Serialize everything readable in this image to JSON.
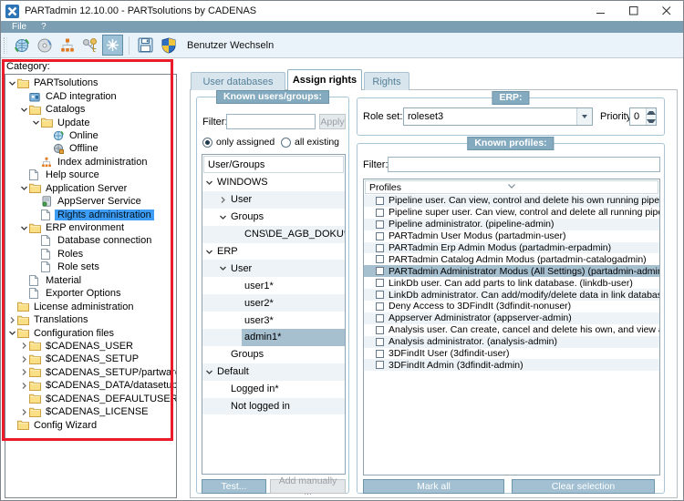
{
  "window": {
    "title": "PARTadmin 12.10.00 - PARTsolutions by CADENAS",
    "icons": [
      "app-logo-icon",
      "minimize-icon",
      "maximize-icon",
      "close-icon"
    ]
  },
  "menu": {
    "items": [
      {
        "label": "File"
      },
      {
        "label": "?"
      }
    ]
  },
  "toolbar": {
    "icons": [
      "update-online-icon",
      "update-offline-icon",
      "index-administration-icon",
      "rights-administration-icon",
      "active-category-icon",
      "save-icon",
      "switch-user-shield-icon"
    ],
    "switch_user_label": "Benutzer Wechseln"
  },
  "category_panel": {
    "label": "Category:",
    "items": [
      {
        "label": "PARTsolutions",
        "icon": "folder-icon",
        "level": 0,
        "arrow": "v"
      },
      {
        "label": "CAD integration",
        "icon": "cad-integration-icon",
        "level": 1
      },
      {
        "label": "Catalogs",
        "icon": "folder-icon",
        "level": 1,
        "arrow": "v"
      },
      {
        "label": "Update",
        "icon": "folder-icon",
        "level": 2,
        "arrow": "v"
      },
      {
        "label": "Online",
        "icon": "online-icon",
        "level": 3
      },
      {
        "label": "Offline",
        "icon": "offline-icon",
        "level": 3
      },
      {
        "label": "Index administration",
        "icon": "index-administration-icon",
        "level": 2
      },
      {
        "label": "Help source",
        "icon": "document-icon",
        "level": 1
      },
      {
        "label": "Application Server",
        "icon": "folder-icon",
        "level": 1,
        "arrow": "v"
      },
      {
        "label": "AppServer Service",
        "icon": "appserver-service-icon",
        "level": 2
      },
      {
        "label": "Rights administration",
        "icon": "document-icon",
        "level": 2,
        "selected": true
      },
      {
        "label": "ERP environment",
        "icon": "folder-icon",
        "level": 1,
        "arrow": "v"
      },
      {
        "label": "Database connection",
        "icon": "document-icon",
        "level": 2
      },
      {
        "label": "Roles",
        "icon": "document-icon",
        "level": 2
      },
      {
        "label": "Role sets",
        "icon": "document-icon",
        "level": 2
      },
      {
        "label": "Material",
        "icon": "document-icon",
        "level": 1
      },
      {
        "label": "Exporter Options",
        "icon": "document-icon",
        "level": 1
      },
      {
        "label": "License administration",
        "icon": "folder-icon",
        "level": 0
      },
      {
        "label": "Translations",
        "icon": "folder-icon",
        "level": 0,
        "arrow": ">"
      },
      {
        "label": "Configuration files",
        "icon": "folder-icon",
        "level": 0,
        "arrow": "v"
      },
      {
        "label": "$CADENAS_USER",
        "icon": "folder-icon",
        "level": 1,
        "arrow": ">"
      },
      {
        "label": "$CADENAS_SETUP",
        "icon": "folder-icon",
        "level": 1,
        "arrow": ">"
      },
      {
        "label": "$CADENAS_SETUP/partwarehouse",
        "icon": "folder-icon",
        "level": 1,
        "arrow": ">"
      },
      {
        "label": "$CADENAS_DATA/datasetup",
        "icon": "folder-icon",
        "level": 1,
        "arrow": ">"
      },
      {
        "label": "$CADENAS_DEFAULTUSER",
        "icon": "folder-icon",
        "level": 1
      },
      {
        "label": "$CADENAS_LICENSE",
        "icon": "folder-icon",
        "level": 1,
        "arrow": ">"
      },
      {
        "label": "Config Wizard",
        "icon": "folder-icon",
        "level": 0
      }
    ]
  },
  "annotation": {
    "color": "#ea1c2c"
  },
  "tabs": [
    {
      "label": "User databases",
      "active": false
    },
    {
      "label": "Assign rights",
      "active": true
    },
    {
      "label": "Rights",
      "active": false
    }
  ],
  "known_users_groups": {
    "group_label": "Known users/groups:",
    "filter_label": "Filter:",
    "filter_value": "",
    "apply_label": "Apply",
    "radio_only_assigned": "only assigned",
    "radio_all_existing": "all existing",
    "radio_selected": "only assigned",
    "list_header": "User/Groups",
    "items": [
      {
        "label": "WINDOWS",
        "level": 0,
        "arrow": "v"
      },
      {
        "label": "User",
        "level": 1,
        "arrow": ">"
      },
      {
        "label": "Groups",
        "level": 1,
        "arrow": "v"
      },
      {
        "label": "CNS\\DE_AGB_DOKU*",
        "level": 2
      },
      {
        "label": "ERP",
        "level": 0,
        "arrow": "v"
      },
      {
        "label": "User",
        "level": 1,
        "arrow": "v"
      },
      {
        "label": "user1*",
        "level": 2
      },
      {
        "label": "user2*",
        "level": 2
      },
      {
        "label": "user3*",
        "level": 2
      },
      {
        "label": "admin1*",
        "level": 2,
        "selected": true
      },
      {
        "label": "Groups",
        "level": 1
      },
      {
        "label": "Default",
        "level": 0,
        "arrow": "v"
      },
      {
        "label": "Logged in*",
        "level": 1
      },
      {
        "label": "Not logged in",
        "level": 1
      }
    ],
    "test_button": "Test...",
    "add_manually_button": "Add manually ..."
  },
  "erp": {
    "group_label": "ERP:",
    "role_set_label": "Role set:",
    "role_set_value": "roleset3",
    "priority_label": "Priority:",
    "priority_value": "0"
  },
  "known_profiles": {
    "group_label": "Known profiles:",
    "filter_label": "Filter:",
    "filter_value": "",
    "list_header": "Profiles",
    "items": [
      {
        "label": "Pipeline user. Can view, control and delete his own running pipelines. C...",
        "checked": false
      },
      {
        "label": "Pipeline super user. Can view, control and delete all running pipelines. (...",
        "checked": false
      },
      {
        "label": "Pipeline administrator. (pipeline-admin)",
        "checked": false
      },
      {
        "label": "PARTadmin User Modus (partadmin-user)",
        "checked": false
      },
      {
        "label": "PARTadmin Erp Admin Modus (partadmin-erpadmin)",
        "checked": false
      },
      {
        "label": "PARTadmin Catalog Admin Modus (partadmin-catalogadmin)",
        "checked": false
      },
      {
        "label": "PARTadmin Administrator Modus (All Settings) (partadmin-admin)",
        "checked": false,
        "selected": true
      },
      {
        "label": "LinkDb user. Can add parts to link database. (linkdb-user)",
        "checked": false
      },
      {
        "label": "LinkDb administrator. Can add/modify/delete data in link database. (link...",
        "checked": false
      },
      {
        "label": "Deny Access to 3DFindIt (3dfindit-nonuser)",
        "checked": false
      },
      {
        "label": "Appserver Administrator (appserver-admin)",
        "checked": false
      },
      {
        "label": "Analysis user. Can create, cancel and delete his own, and view all analys...",
        "checked": false
      },
      {
        "label": "Analysis administrator. (analysis-admin)",
        "checked": false
      },
      {
        "label": "3DFindIt User (3dfindit-user)",
        "checked": false
      },
      {
        "label": "3DFindIt Admin (3dfindit-admin)",
        "checked": false
      }
    ],
    "mark_all_button": "Mark all",
    "clear_selection_button": "Clear selection"
  },
  "colors": {
    "selection_blue": "#3d9df5",
    "selection_muted": "#a7c0d0",
    "menubar": "#7b9eb3",
    "toolbar": "#e9f3f9",
    "group_badge": "#84aabf",
    "annotation_red": "#ea1c2c"
  }
}
